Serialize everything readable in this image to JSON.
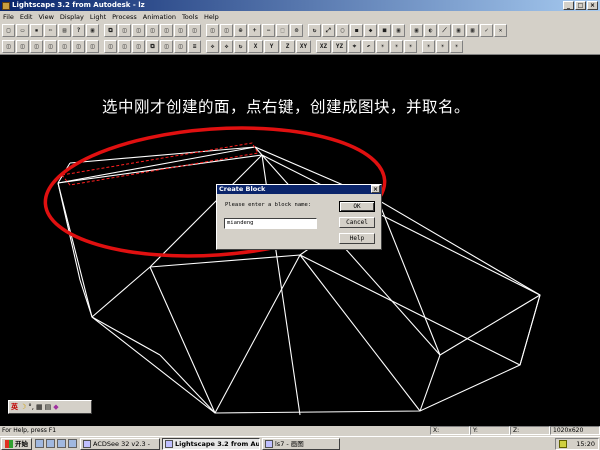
{
  "window": {
    "title": "Lightscape 3.2 from Autodesk - lz",
    "minimize": "_",
    "maximize": "□",
    "close": "×"
  },
  "menu": [
    "File",
    "Edit",
    "View",
    "Display",
    "Light",
    "Process",
    "Animation",
    "Tools",
    "Help"
  ],
  "toolbar_row1": [
    "new",
    "open",
    "save",
    "cut",
    "print",
    "help",
    "block",
    "copy",
    "view",
    "view",
    "view",
    "view",
    "view",
    "view",
    "view",
    "view",
    "zoom",
    "zoom-in",
    "zoom-out",
    "zoom-box",
    "zoom-all",
    "rotate",
    "zoom-ext",
    "select",
    "fill",
    "shade",
    "solid",
    "box",
    "box",
    "paint",
    "wire",
    "box",
    "grid",
    "ok",
    "close"
  ],
  "toolbar_row2": [
    "view",
    "view",
    "view",
    "view",
    "view",
    "view",
    "view",
    "view",
    "view",
    "view",
    "copy",
    "view",
    "view",
    "layer",
    "move",
    "move",
    "rotate",
    "X",
    "Y",
    "Z",
    "XY",
    "XZ",
    "YZ",
    "snap",
    "undo",
    "light",
    "light",
    "light",
    "light",
    "light",
    "light"
  ],
  "annotation": "选中刚才创建的面，点右键，创建成图块，并取名。",
  "dialog": {
    "title": "Create Block",
    "close": "×",
    "prompt": "Please enter a block name:",
    "input_value": "miandeng",
    "ok": "OK",
    "cancel": "Cancel",
    "help": "Help"
  },
  "ime": {
    "lang": "英",
    "icons": [
      "moon",
      "comma",
      "keyboard",
      "grid",
      "palette"
    ]
  },
  "status": {
    "help": "For Help, press F1",
    "x": "X:",
    "y": "Y:",
    "z": "Z:",
    "resolution": "1020x620"
  },
  "taskbar": {
    "start": "开始",
    "tasks": [
      "ACDSee 32 v2.3 -",
      "Lightscape 3.2 from Auto...",
      "ls7 - 画图"
    ],
    "clock": "15:20"
  },
  "colors": {
    "titlebar": "#08246b",
    "annotation_ellipse": "#e01010",
    "wireframe": "#ffffff",
    "selected_face": "#ff2020"
  }
}
